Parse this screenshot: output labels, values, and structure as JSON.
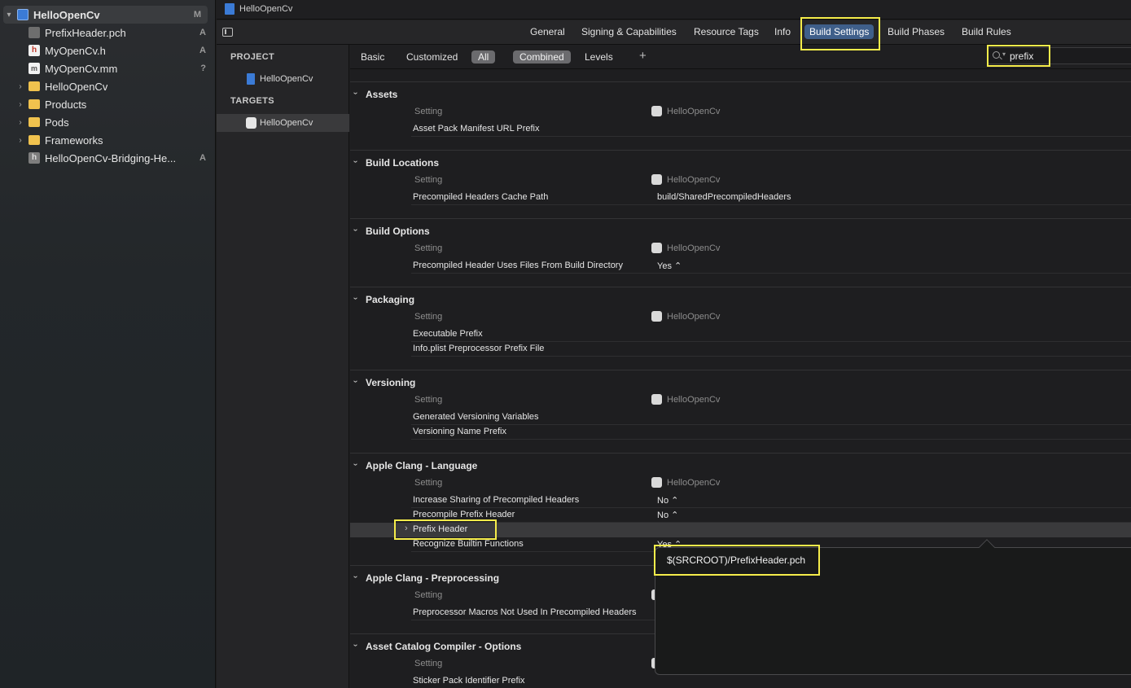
{
  "navigator": {
    "items": [
      {
        "label": "HelloOpenCv",
        "badge": "M",
        "icon": "project-icon",
        "disclosure": "▾"
      },
      {
        "label": "PrefixHeader.pch",
        "badge": "A",
        "icon": "pch-file-icon"
      },
      {
        "label": "MyOpenCv.h",
        "badge": "A",
        "icon": "header-file-icon",
        "glyph": "h"
      },
      {
        "label": "MyOpenCv.mm",
        "badge": "?",
        "icon": "objc-file-icon",
        "glyph": "m"
      },
      {
        "label": "HelloOpenCv",
        "icon": "folder-icon",
        "disclosure": "›"
      },
      {
        "label": "Products",
        "icon": "folder-icon",
        "disclosure": "›"
      },
      {
        "label": "Pods",
        "icon": "folder-icon",
        "disclosure": "›"
      },
      {
        "label": "Frameworks",
        "icon": "folder-icon",
        "disclosure": "›"
      },
      {
        "label": "HelloOpenCv-Bridging-He...",
        "badge": "A",
        "icon": "header-file-icon",
        "glyph": "h"
      }
    ]
  },
  "jumpbar": {
    "title": "HelloOpenCv"
  },
  "tabs": [
    "General",
    "Signing & Capabilities",
    "Resource Tags",
    "Info",
    "Build Settings",
    "Build Phases",
    "Build Rules"
  ],
  "targets": {
    "project_header": "PROJECT",
    "project_item": "HelloOpenCv",
    "targets_header": "TARGETS",
    "target_item": "HelloOpenCv"
  },
  "filter": {
    "basic": "Basic",
    "customized": "Customized",
    "all": "All",
    "combined": "Combined",
    "levels": "Levels",
    "add": "+",
    "search_value": "prefix"
  },
  "column": {
    "setting": "Setting",
    "target": "HelloOpenCv"
  },
  "sections": [
    {
      "title": "Assets",
      "rows": [
        {
          "name": "Asset Pack Manifest URL Prefix",
          "value": ""
        }
      ]
    },
    {
      "title": "Build Locations",
      "rows": [
        {
          "name": "Precompiled Headers Cache Path",
          "value": "build/SharedPrecompiledHeaders"
        }
      ]
    },
    {
      "title": "Build Options",
      "rows": [
        {
          "name": "Precompiled Header Uses Files From Build Directory",
          "value": "Yes ⌃"
        }
      ]
    },
    {
      "title": "Packaging",
      "rows": [
        {
          "name": "Executable Prefix",
          "value": ""
        },
        {
          "name": "Info.plist Preprocessor Prefix File",
          "value": ""
        }
      ]
    },
    {
      "title": "Versioning",
      "rows": [
        {
          "name": "Generated Versioning Variables",
          "value": ""
        },
        {
          "name": "Versioning Name Prefix",
          "value": ""
        }
      ]
    },
    {
      "title": "Apple Clang - Language",
      "rows": [
        {
          "name": "Increase Sharing of Precompiled Headers",
          "value": "No ⌃"
        },
        {
          "name": "Precompile Prefix Header",
          "value": "No ⌃"
        },
        {
          "name": "Prefix Header",
          "value": ""
        },
        {
          "name": "Recognize Builtin Functions",
          "value": "Yes ⌃"
        }
      ]
    },
    {
      "title": "Apple Clang - Preprocessing",
      "rows": [
        {
          "name": "Preprocessor Macros Not Used In Precompiled Headers",
          "value": ""
        }
      ]
    },
    {
      "title": "Asset Catalog Compiler - Options",
      "rows": [
        {
          "name": "Sticker Pack Identifier Prefix",
          "value": ""
        }
      ]
    }
  ],
  "popover": {
    "text": "$(SRCROOT)/PrefixHeader.pch"
  }
}
